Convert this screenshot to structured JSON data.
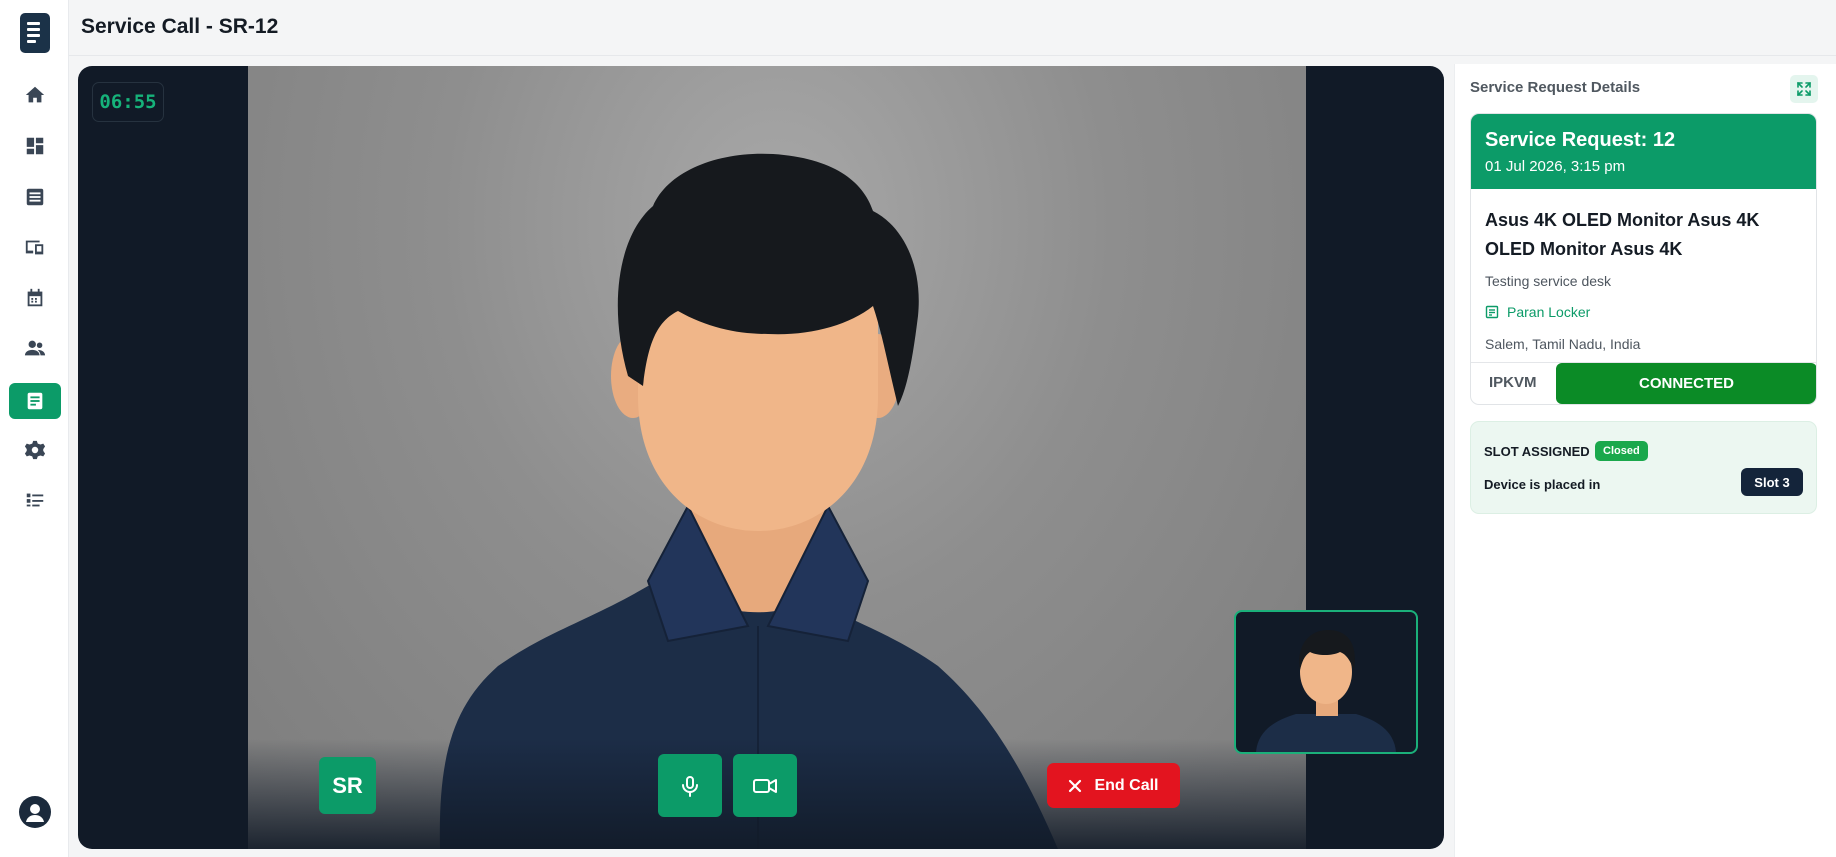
{
  "app": {
    "page_title": "Service Call - SR-12"
  },
  "sidebar": {
    "items": [
      {
        "icon": "home-icon",
        "active": false
      },
      {
        "icon": "dashboard-icon",
        "active": false
      },
      {
        "icon": "inventory-icon",
        "active": false
      },
      {
        "icon": "devices-icon",
        "active": false
      },
      {
        "icon": "calendar-icon",
        "active": false
      },
      {
        "icon": "users-icon",
        "active": false
      },
      {
        "icon": "service-request-icon",
        "active": true
      },
      {
        "icon": "settings-icon",
        "active": false
      },
      {
        "icon": "list-icon",
        "active": false
      }
    ],
    "profile_icon": "account-circle-icon"
  },
  "call": {
    "timer": "06:55",
    "caller_initials": "SR",
    "mic_icon": "microphone-icon",
    "camera_icon": "video-camera-icon",
    "end_call_label": "End Call"
  },
  "panel": {
    "title": "Service Request Details",
    "expand_icon": "expand-icon",
    "request": {
      "title": "Service Request: 12",
      "date": "01 Jul 2026, 3:15 pm",
      "product": "Asus 4K OLED Monitor Asus 4K OLED Monitor Asus 4K",
      "description": "Testing service desk",
      "customer": "Paran Locker",
      "location": "Salem, Tamil Nadu, India",
      "connection_type": "IPKVM",
      "connection_status": "CONNECTED"
    },
    "slot": {
      "label": "SLOT ASSIGNED",
      "status": "Closed",
      "text": "Device is placed in",
      "slot": "Slot 3"
    }
  },
  "colors": {
    "accent": "#0c9b68",
    "connected": "#0b8b26",
    "end_call": "#e3141f",
    "navy": "#14243a"
  }
}
